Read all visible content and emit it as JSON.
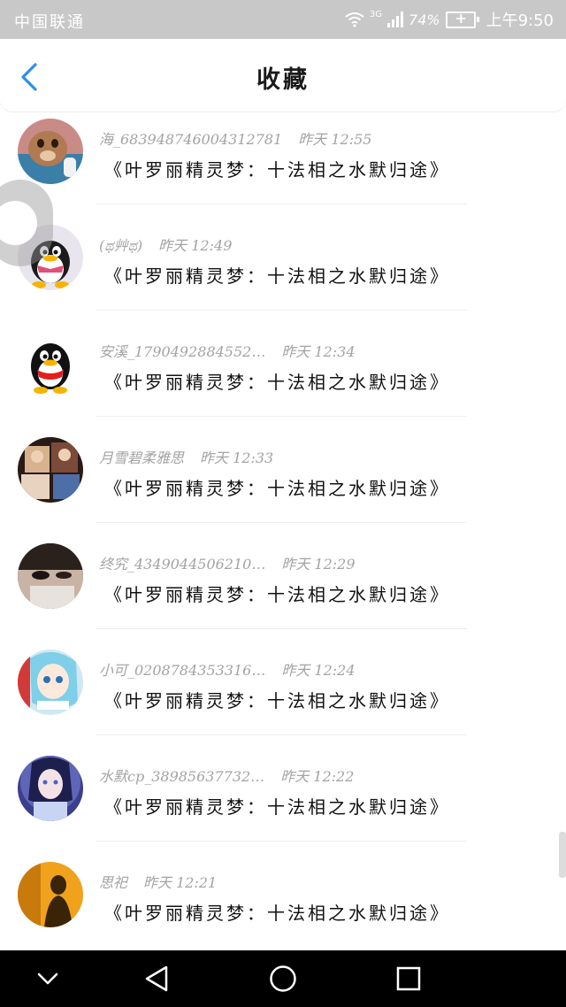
{
  "status_bar": {
    "carrier": "中国联通",
    "network": "3G",
    "battery": "74%",
    "time": "上午9:50"
  },
  "header": {
    "title": "收藏",
    "back_icon": "chevron-left-icon",
    "accent_color": "#2f8ef0"
  },
  "items": [
    {
      "name": "海_683948746004312781",
      "time": "昨天 12:55",
      "title": "《叶罗丽精灵梦：十法相之水默归途》",
      "avatar": "avatar-dog-plush"
    },
    {
      "name": "(ಥ艸ಥ)",
      "time": "昨天 12:49",
      "title": "《叶罗丽精灵梦：十法相之水默归途》",
      "avatar": "avatar-qq-penguin-pink"
    },
    {
      "name": "安溪_1790492884552…",
      "time": "昨天 12:34",
      "title": "《叶罗丽精灵梦：十法相之水默归途》",
      "avatar": "avatar-qq-penguin"
    },
    {
      "name": "月雪碧柔雅思",
      "time": "昨天 12:33",
      "title": "《叶罗丽精灵梦：十法相之水默归途》",
      "avatar": "avatar-photo-collage"
    },
    {
      "name": "终究_4349044506210…",
      "time": "昨天 12:29",
      "title": "《叶罗丽精灵梦：十法相之水默归途》",
      "avatar": "avatar-face-closeup"
    },
    {
      "name": "小可_0208784353316…",
      "time": "昨天 12:24",
      "title": "《叶罗丽精灵梦：十法相之水默归途》",
      "avatar": "avatar-anime-girl"
    },
    {
      "name": "水默cp_38985637732…",
      "time": "昨天 12:22",
      "title": "《叶罗丽精灵梦：十法相之水默归途》",
      "avatar": "avatar-anime-blue"
    },
    {
      "name": "思祀",
      "time": "昨天 12:21",
      "title": "《叶罗丽精灵梦：十法相之水默归途》",
      "avatar": "avatar-silhouette-orange"
    }
  ],
  "nav_bar": {
    "icons": [
      "chevron-down-icon",
      "back-triangle-icon",
      "home-circle-icon",
      "recents-square-icon"
    ]
  }
}
